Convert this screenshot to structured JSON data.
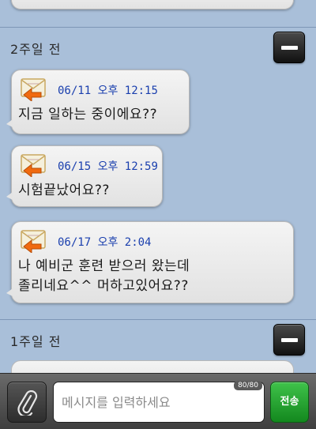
{
  "sections": [
    {
      "title": "2주일 전"
    },
    {
      "title": "1주일 전"
    }
  ],
  "messages": [
    {
      "time": "06/11 오후 12:15",
      "text": "지금 일하는 중이에요??"
    },
    {
      "time": "06/15 오후 12:59",
      "text": "시험끝났어요??"
    },
    {
      "time": "06/17 오후 2:04",
      "text": "나 예비군 훈련 받으러 왔는데\n졸리네요^^ 머하고있어요??"
    }
  ],
  "composer": {
    "placeholder": "메시지를 입력하세요",
    "char_count": "80/80",
    "send_label": "전송"
  },
  "colors": {
    "background": "#a9bfd9",
    "timestamp": "#1a3fae",
    "send_button": "#20a22c",
    "envelope_arrow": "#f06a10"
  }
}
